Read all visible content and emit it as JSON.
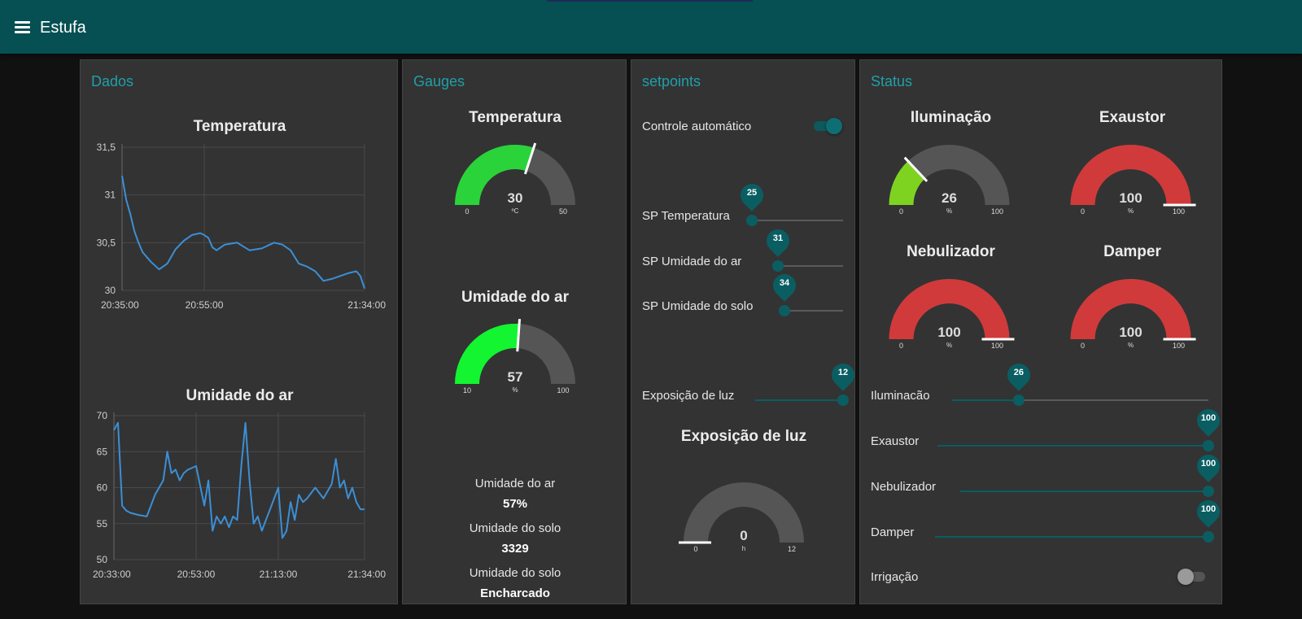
{
  "app": {
    "title": "Estufa"
  },
  "groups": {
    "dados": "Dados",
    "gauges": "Gauges",
    "setpoints": "setpoints",
    "status": "Status"
  },
  "colors": {
    "header": "#064f53",
    "accent_title": "#1fa0a8",
    "slider": "#0a5e62",
    "gauge_green": "#2ad33a",
    "gauge_bright_green": "#12f530",
    "gauge_lime": "#7ed321",
    "gauge_red": "#d13a3a",
    "gauge_track": "#555555",
    "chart_line": "#3b8fd6"
  },
  "charts": {
    "temperatura": {
      "title": "Temperatura"
    },
    "umidade": {
      "title": "Umidade do ar"
    }
  },
  "chart_data": [
    {
      "type": "line",
      "title": "Temperatura",
      "xlabel": "",
      "ylabel": "",
      "ylim": [
        30,
        31.5
      ],
      "yticks": [
        "31,5",
        "31",
        "30,5",
        "30"
      ],
      "xticks": [
        "20:35:00",
        "20:55:00",
        "21:34:00"
      ],
      "x": [
        "20:35",
        "20:36",
        "20:37",
        "20:38",
        "20:39",
        "20:40",
        "20:42",
        "20:44",
        "20:46",
        "20:48",
        "20:50",
        "20:52",
        "20:54",
        "20:55",
        "20:56",
        "20:57",
        "20:58",
        "21:00",
        "21:03",
        "21:06",
        "21:09",
        "21:11",
        "21:12",
        "21:14",
        "21:16",
        "21:18",
        "21:20",
        "21:22",
        "21:24",
        "21:26",
        "21:28",
        "21:30",
        "21:32",
        "21:33",
        "21:34"
      ],
      "series": [
        {
          "values": [
            31.2,
            30.95,
            30.8,
            30.62,
            30.5,
            30.4,
            30.3,
            30.22,
            30.28,
            30.43,
            30.52,
            30.58,
            30.6,
            30.58,
            30.55,
            30.45,
            30.42,
            30.48,
            30.5,
            30.42,
            30.44,
            30.48,
            30.5,
            30.48,
            30.42,
            30.28,
            30.25,
            30.2,
            30.1,
            30.12,
            30.15,
            30.18,
            30.2,
            30.15,
            30.02
          ]
        }
      ]
    },
    {
      "type": "line",
      "title": "Umidade do ar",
      "xlabel": "",
      "ylabel": "",
      "ylim": [
        50,
        70
      ],
      "yticks": [
        "70",
        "65",
        "60",
        "55",
        "50"
      ],
      "xticks": [
        "20:33:00",
        "20:53:00",
        "21:13:00",
        "21:34:00"
      ],
      "x": [
        "20:33",
        "20:34",
        "20:35",
        "20:36",
        "20:37",
        "20:39",
        "20:41",
        "20:43",
        "20:45",
        "20:46",
        "20:47",
        "20:48",
        "20:49",
        "20:50",
        "20:51",
        "20:53",
        "20:55",
        "20:56",
        "20:57",
        "20:58",
        "20:59",
        "21:00",
        "21:01",
        "21:02",
        "21:03",
        "21:04",
        "21:05",
        "21:06",
        "21:07",
        "21:08",
        "21:09",
        "21:10",
        "21:11",
        "21:12",
        "21:13",
        "21:14",
        "21:15",
        "21:16",
        "21:17",
        "21:18",
        "21:19",
        "21:20",
        "21:22",
        "21:24",
        "21:26",
        "21:27",
        "21:28",
        "21:29",
        "21:30",
        "21:31",
        "21:32",
        "21:33",
        "21:34"
      ],
      "series": [
        {
          "values": [
            68,
            69,
            57.5,
            56.8,
            56.5,
            56.2,
            56,
            59,
            61,
            65,
            62,
            62.5,
            61,
            62,
            62.5,
            63,
            57.5,
            61,
            54,
            56,
            55,
            56,
            54.5,
            56,
            55.5,
            63,
            69,
            61,
            55,
            56,
            54,
            55.5,
            57,
            58.5,
            60,
            53,
            54,
            58,
            55.5,
            59,
            58,
            58.5,
            60,
            58.5,
            60.5,
            64,
            60,
            61,
            58.5,
            60,
            58,
            57,
            57
          ]
        }
      ]
    }
  ],
  "gauges": {
    "temperatura": {
      "title": "Temperatura",
      "value": "30",
      "unit": "ºC",
      "min": "0",
      "max": "50",
      "level": 0.6
    },
    "umidade": {
      "title": "Umidade do ar",
      "value": "57",
      "unit": "%",
      "min": "10",
      "max": "100",
      "level": 0.522
    },
    "exposicao": {
      "title": "Exposição de luz",
      "value": "0",
      "unit": "h",
      "min": "0",
      "max": "12",
      "level": 0.0
    },
    "iluminacao": {
      "title": "Iluminação",
      "value": "26",
      "unit": "%",
      "min": "0",
      "max": "100",
      "level": 0.26
    },
    "exaustor": {
      "title": "Exaustor",
      "value": "100",
      "unit": "%",
      "min": "0",
      "max": "100",
      "level": 1.0
    },
    "nebulizador": {
      "title": "Nebulizador",
      "value": "100",
      "unit": "%",
      "min": "0",
      "max": "100",
      "level": 1.0
    },
    "damper": {
      "title": "Damper",
      "value": "100",
      "unit": "%",
      "min": "0",
      "max": "100",
      "level": 1.0
    }
  },
  "texts": {
    "umidade_ar": {
      "label": "Umidade do ar",
      "value": "57%"
    },
    "umidade_solo": {
      "label": "Umidade do solo",
      "value": "3329"
    },
    "umidade_solo_status": {
      "label": "Umidade do solo",
      "value": "Encharcado"
    }
  },
  "setpoints": {
    "controle_auto": {
      "label": "Controle automático",
      "on": true
    },
    "sp_temperatura": {
      "label": "SP Temperatura",
      "value": "25",
      "level": 0.0
    },
    "sp_umidade_ar": {
      "label": "SP Umidade do ar",
      "value": "31",
      "level": 0.0
    },
    "sp_umidade_solo": {
      "label": "SP Umidade do solo",
      "value": "34",
      "level": 0.0
    },
    "exposicao_luz": {
      "label": "Exposição de luz",
      "value": "12",
      "level": 1.0
    }
  },
  "status_controls": {
    "iluminacao": {
      "label": "Iluminacão",
      "value": "26",
      "level": 0.26
    },
    "exaustor": {
      "label": "Exaustor",
      "value": "100",
      "level": 1.0
    },
    "nebulizador": {
      "label": "Nebulizador",
      "value": "100",
      "level": 1.0
    },
    "damper": {
      "label": "Damper",
      "value": "100",
      "level": 1.0
    },
    "irrigacao": {
      "label": "Irrigação",
      "on": false
    }
  }
}
